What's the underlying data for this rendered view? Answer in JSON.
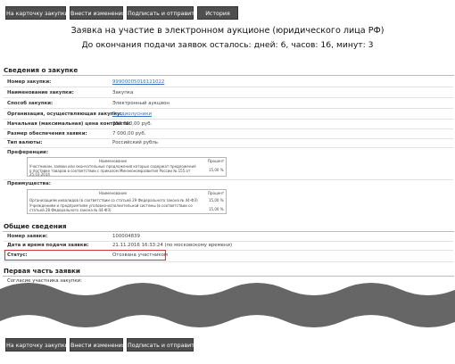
{
  "toolbar": {
    "back_to_card": "На карточку закупки",
    "make_changes": "Внести изменения",
    "sign_and_send": "Подписать и отправить",
    "history": "История"
  },
  "header": {
    "title": "Заявка на участие в электронном аукционе (юридического лица РФ)",
    "deadline": "До окончания подачи заявок осталось: дней: 6, часов: 16, минут: 3"
  },
  "procurement": {
    "section_title": "Сведения о закупке",
    "rows": [
      {
        "label": "Номер закупки:",
        "value": "99900005016121022"
      },
      {
        "label": "Наименование закупки:",
        "value": "Закупка"
      },
      {
        "label": "Способ закупки:",
        "value": "Электронный аукцион"
      },
      {
        "label": "Организация, осуществляющая закупку:",
        "value": "Гладиолусники"
      },
      {
        "label": "Начальная (максимальная) цена контракта:",
        "value": "350 000,00 руб."
      },
      {
        "label": "Размер обеспечения заявки:",
        "value": "7 000,00 руб."
      },
      {
        "label": "Тип валюты:",
        "value": "Российский рубль"
      }
    ],
    "preferences_label": "Преференции:",
    "preferences_table": {
      "headers": [
        "Наименование",
        "Процент"
      ],
      "rows": [
        {
          "name": "Участникам, заявки или окончательные предложения которых содержат предложения о поставке товаров в соответствии с приказом Минэкономразвития России № 155 от 25.03.2014",
          "percent": "15,00 %"
        }
      ]
    },
    "advantages_label": "Преимущества:",
    "advantages_table": {
      "headers": [
        "Наименование",
        "Процент"
      ],
      "rows": [
        {
          "name": "Организациям инвалидов (в соответствии со статьей 29 Федерального закона № 44-ФЗ)",
          "percent": "15,00 %"
        },
        {
          "name": "Учреждениям и предприятиям уголовно-исполнительной системы (в соответствии со статьей 28 Федерального закона № 44-ФЗ)",
          "percent": "15,00 %"
        }
      ]
    }
  },
  "general": {
    "section_title": "Общие сведения",
    "rows": [
      {
        "label": "Номер заявки:",
        "value": "100004839"
      },
      {
        "label": "Дата и время подачи заявки:",
        "value": "21.11.2016 16:33:24 (по московскому времени)"
      },
      {
        "label": "Статус:",
        "value": "Отозвана участником"
      }
    ]
  },
  "first_part": {
    "section_title": "Первая часть заявки",
    "subtitle": "Согласие участника закупки:"
  },
  "colors": {
    "button": "#4f4f4f",
    "link": "#3a6fbf",
    "status_highlight": "#d23a3a",
    "tear": "#666666"
  }
}
